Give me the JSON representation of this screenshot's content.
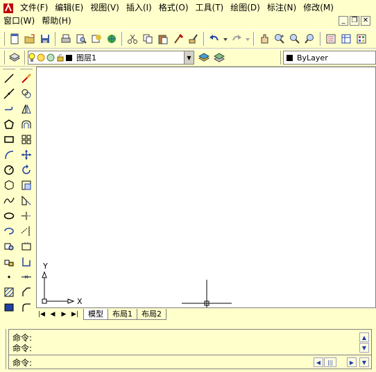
{
  "menu_row1": [
    "文件(F)",
    "编辑(E)",
    "视图(V)",
    "插入(I)",
    "格式(O)",
    "工具(T)",
    "绘图(D)",
    "标注(N)",
    "修改(M)"
  ],
  "menu_row2": [
    "窗口(W)",
    "帮助(H)"
  ],
  "window_controls": {
    "minimize": "_",
    "restore": "❐",
    "close": "✕"
  },
  "layer_combo": {
    "value": "图层1"
  },
  "color_combo": {
    "value": "ByLayer"
  },
  "ucs": {
    "x_label": "X",
    "y_label": "Y"
  },
  "layout_tabs": [
    "模型",
    "布局1",
    "布局2"
  ],
  "command": {
    "history": [
      "命令:",
      "命令:"
    ],
    "prompt": "命令:"
  },
  "icons": {
    "standard_toolbar": [
      "new-icon",
      "open-icon",
      "save-icon",
      "print-icon",
      "preview-icon",
      "publish-icon",
      "3d-icon",
      "cut-icon",
      "copy-icon",
      "paste-icon",
      "match-properties-icon",
      "brush-icon",
      "undo-icon",
      "redo-icon",
      "pan-icon",
      "zoom-realtime-icon",
      "zoom-window-icon",
      "zoom-previous-icon",
      "properties-icon",
      "design-center-icon",
      "tool-palette-icon"
    ],
    "draw_toolbar": [
      "line-icon",
      "construction-line-icon",
      "polyline-icon",
      "polygon-icon",
      "rectangle-icon",
      "arc-icon",
      "circle-icon",
      "revision-cloud-icon",
      "spline-icon",
      "ellipse-icon",
      "ellipse-arc-icon",
      "insert-block-icon",
      "make-block-icon",
      "point-icon",
      "hatch-icon",
      "region-icon"
    ],
    "modify_toolbar": [
      "erase-icon",
      "copy-object-icon",
      "mirror-icon",
      "offset-icon",
      "array-icon",
      "move-icon",
      "rotate-icon",
      "scale-icon",
      "stretch-icon",
      "trim-icon",
      "extend-icon",
      "break-icon",
      "join-icon",
      "chamfer-icon",
      "fillet-icon",
      "explode-icon"
    ]
  },
  "colors": {
    "background": "#ffffcc",
    "canvas": "#ffffff",
    "accent": "#2040a0"
  }
}
